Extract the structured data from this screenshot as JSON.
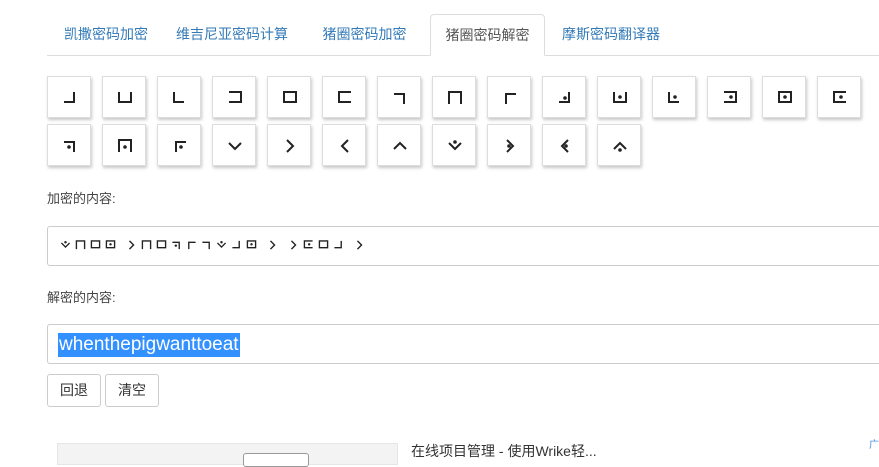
{
  "tabs": [
    {
      "label": "凯撒密码加密",
      "active": false
    },
    {
      "label": "维吉尼亚密码计算",
      "active": false
    },
    {
      "label": "猪圈密码加密",
      "active": false
    },
    {
      "label": "猪圈密码解密",
      "active": true
    },
    {
      "label": "摩斯密码翻译器",
      "active": false
    }
  ],
  "keys": [
    {
      "symbol": "pigpen-a"
    },
    {
      "symbol": "pigpen-b"
    },
    {
      "symbol": "pigpen-c"
    },
    {
      "symbol": "pigpen-d"
    },
    {
      "symbol": "pigpen-e"
    },
    {
      "symbol": "pigpen-f"
    },
    {
      "symbol": "pigpen-g"
    },
    {
      "symbol": "pigpen-h"
    },
    {
      "symbol": "pigpen-i"
    },
    {
      "symbol": "pigpen-j"
    },
    {
      "symbol": "pigpen-k"
    },
    {
      "symbol": "pigpen-l"
    },
    {
      "symbol": "pigpen-m"
    },
    {
      "symbol": "pigpen-n"
    },
    {
      "symbol": "pigpen-o"
    },
    {
      "symbol": "pigpen-p"
    },
    {
      "symbol": "pigpen-q"
    },
    {
      "symbol": "pigpen-r"
    },
    {
      "symbol": "pigpen-s"
    },
    {
      "symbol": "pigpen-t"
    },
    {
      "symbol": "pigpen-u"
    },
    {
      "symbol": "pigpen-v"
    },
    {
      "symbol": "pigpen-w"
    },
    {
      "symbol": "pigpen-x"
    },
    {
      "symbol": "pigpen-y"
    },
    {
      "symbol": "pigpen-z"
    }
  ],
  "encrypt": {
    "label": "加密的内容:",
    "symbols": [
      "pigpen-w",
      "pigpen-h",
      "pigpen-e",
      "pigpen-n",
      "space",
      "pigpen-t",
      "pigpen-h",
      "pigpen-e",
      "pigpen-p",
      "pigpen-i",
      "pigpen-g",
      "pigpen-w",
      "pigpen-a",
      "pigpen-n",
      "space",
      "pigpen-t",
      "space",
      "pigpen-t",
      "pigpen-o",
      "pigpen-e",
      "pigpen-a",
      "space",
      "pigpen-t"
    ]
  },
  "decrypt": {
    "label": "解密的内容:",
    "value": "whenthepigwanttoeat"
  },
  "buttons": {
    "back": "回退",
    "clear": "清空"
  },
  "ad": {
    "text": "在线项目管理 - 使用Wrike轻...",
    "mark": "广"
  }
}
